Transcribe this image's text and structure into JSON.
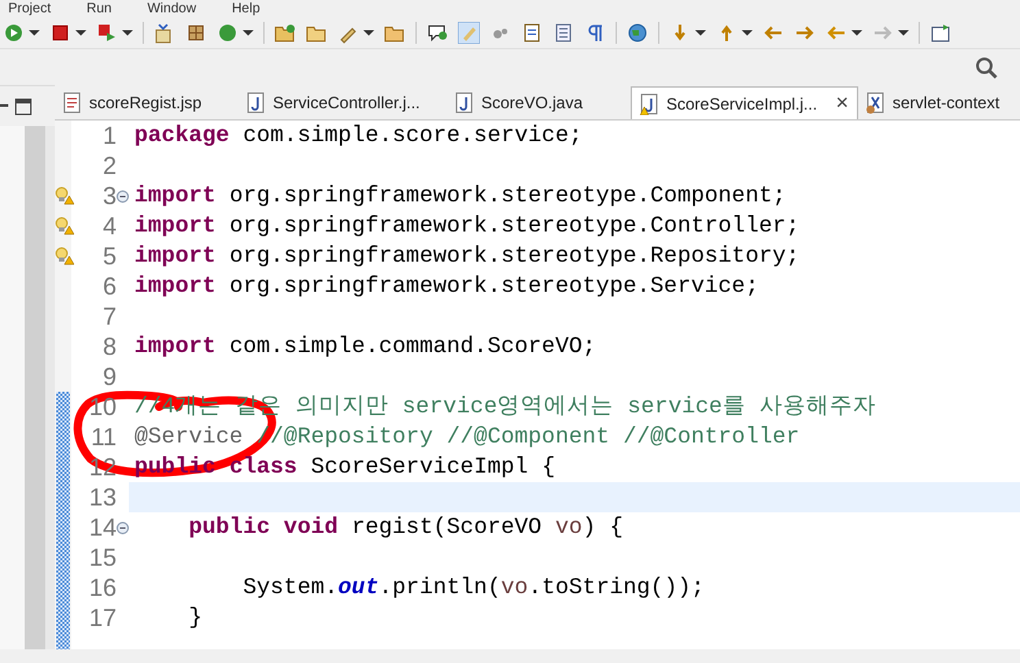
{
  "menu": [
    "Project",
    "Run",
    "Window",
    "Help"
  ],
  "tabs": [
    {
      "label": "scoreRegist.jsp",
      "kind": "jsp",
      "selected": false
    },
    {
      "label": "ServiceController.j...",
      "kind": "java",
      "selected": false
    },
    {
      "label": "ScoreVO.java",
      "kind": "java",
      "selected": false
    },
    {
      "label": "ScoreServiceImpl.j...",
      "kind": "java-warning",
      "selected": true,
      "close": "×"
    },
    {
      "label": "servlet-context",
      "kind": "xml",
      "selected": false
    }
  ],
  "lines": [
    {
      "number": "1",
      "warning": false,
      "fold": false,
      "current": false,
      "segments": [
        {
          "kind": "keyword",
          "text": "package"
        },
        {
          "kind": "plain",
          "text": " com.simple.score.service;"
        }
      ]
    },
    {
      "number": "2",
      "warning": false,
      "fold": false,
      "current": false
    },
    {
      "number": "3",
      "warning": true,
      "fold": true,
      "current": false,
      "segments": [
        {
          "kind": "keyword",
          "text": "import"
        },
        {
          "kind": "plain",
          "text": " org.springframework.stereotype.Component;"
        }
      ]
    },
    {
      "number": "4",
      "warning": true,
      "fold": false,
      "current": false,
      "segments": [
        {
          "kind": "keyword",
          "text": "import"
        },
        {
          "kind": "plain",
          "text": " org.springframework.stereotype.Controller;"
        }
      ]
    },
    {
      "number": "5",
      "warning": true,
      "fold": false,
      "current": false,
      "segments": [
        {
          "kind": "keyword",
          "text": "import"
        },
        {
          "kind": "plain",
          "text": " org.springframework.stereotype.Repository;"
        }
      ]
    },
    {
      "number": "6",
      "warning": false,
      "fold": false,
      "current": false,
      "segments": [
        {
          "kind": "keyword",
          "text": "import"
        },
        {
          "kind": "plain",
          "text": " org.springframework.stereotype.Service;"
        }
      ]
    },
    {
      "number": "7",
      "warning": false,
      "fold": false,
      "current": false
    },
    {
      "number": "8",
      "warning": false,
      "fold": false,
      "current": false,
      "segments": [
        {
          "kind": "keyword",
          "text": "import"
        },
        {
          "kind": "plain",
          "text": " com.simple.command.ScoreVO;"
        }
      ]
    },
    {
      "number": "9",
      "warning": false,
      "fold": false,
      "current": false
    },
    {
      "number": "10",
      "warning": false,
      "fold": false,
      "current": false,
      "segments": [
        {
          "kind": "comment",
          "text": "//4개는 같은 의미지만 service영역에서는 service를 사용해주자"
        }
      ]
    },
    {
      "number": "11",
      "warning": false,
      "fold": false,
      "current": false,
      "segments": [
        {
          "kind": "annotation",
          "text": "@Service"
        },
        {
          "kind": "comment",
          "text": " //@Repository //@Component //@Controller"
        }
      ]
    },
    {
      "number": "12",
      "warning": false,
      "fold": false,
      "current": false,
      "segments": [
        {
          "kind": "keyword",
          "text": "public"
        },
        {
          "kind": "keyword",
          "text": " class"
        },
        {
          "kind": "plain",
          "text": " ScoreServiceImpl {"
        }
      ]
    },
    {
      "number": "13",
      "warning": false,
      "fold": false,
      "current": true
    },
    {
      "number": "14",
      "warning": false,
      "fold": true,
      "current": false,
      "segments": [
        {
          "kind": "keyword",
          "text": "    public"
        },
        {
          "kind": "keyword",
          "text": " void"
        },
        {
          "kind": "plain",
          "text": " regist(ScoreVO "
        },
        {
          "kind": "local",
          "text": "vo"
        },
        {
          "kind": "plain",
          "text": ") {"
        }
      ]
    },
    {
      "number": "15",
      "warning": false,
      "fold": false,
      "current": false
    },
    {
      "number": "16",
      "warning": false,
      "fold": false,
      "current": false,
      "segments": [
        {
          "kind": "plain",
          "text": "        System."
        },
        {
          "kind": "static",
          "text": "out"
        },
        {
          "kind": "plain",
          "text": ".println("
        },
        {
          "kind": "local",
          "text": "vo"
        },
        {
          "kind": "plain",
          "text": ".toString());"
        }
      ]
    },
    {
      "number": "17",
      "warning": false,
      "fold": false,
      "current": false,
      "segments": [
        {
          "kind": "plain",
          "text": "    }"
        }
      ]
    }
  ]
}
